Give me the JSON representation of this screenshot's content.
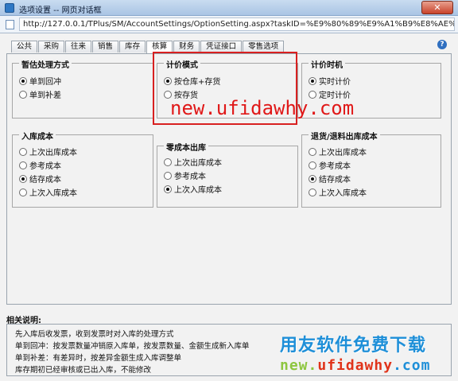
{
  "window": {
    "title": "选项设置 -- 网页对话框"
  },
  "address": {
    "url": "http://127.0.0.1/TPlus/SM/AccountSettings/OptionSetting.aspx?taskID=%E9%80%89%E9%A1%B9%E8%AE%BE%E"
  },
  "tabs": [
    "公共",
    "采购",
    "往来",
    "销售",
    "库存",
    "核算",
    "财务",
    "凭证接口",
    "零售选项"
  ],
  "active_tab": "核算",
  "groups": {
    "provisional": {
      "title": "暂估处理方式",
      "options": [
        "单到回冲",
        "单到补差"
      ],
      "selected": "单到回冲"
    },
    "pricing_mode": {
      "title": "计价模式",
      "options": [
        "按仓库+存货",
        "按存货"
      ],
      "selected": "按仓库+存货"
    },
    "pricing_time": {
      "title": "计价时机",
      "options": [
        "实时计价",
        "定时计价"
      ],
      "selected": "实时计价"
    },
    "inbound_cost": {
      "title": "入库成本",
      "options": [
        "上次出库成本",
        "参考成本",
        "结存成本",
        "上次入库成本"
      ],
      "selected": "结存成本"
    },
    "zero_cost_outbound": {
      "title": "零成本出库",
      "options": [
        "上次出库成本",
        "参考成本",
        "上次入库成本"
      ],
      "selected": "上次入库成本"
    },
    "return_cost": {
      "title": "退货/退料出库成本",
      "options": [
        "上次出库成本",
        "参考成本",
        "结存成本",
        "上次入库成本"
      ],
      "selected": "结存成本"
    }
  },
  "watermark": {
    "url": "new.ufidawhy.com",
    "brand_cn": "用友软件免费下载",
    "brand_url_parts": [
      "new.",
      "ufidawhy",
      ".com"
    ],
    "colors": {
      "red": "#e01818",
      "blue": "#1e8fd8",
      "green": "#8dc63f"
    }
  },
  "notes": {
    "title": "相关说明:",
    "lines": [
      "先入库后收发票，收到发票时对入库的处理方式",
      "单到回冲：按发票数量冲销原入库单，按发票数量、金额生成新入库单",
      "单到补差：有差异时，按差异金额生成入库调整单",
      "库存期初已经审核或已出入库，不能修改"
    ]
  },
  "icons": {
    "help": "help-icon",
    "close": "close-icon",
    "page": "page-icon"
  }
}
